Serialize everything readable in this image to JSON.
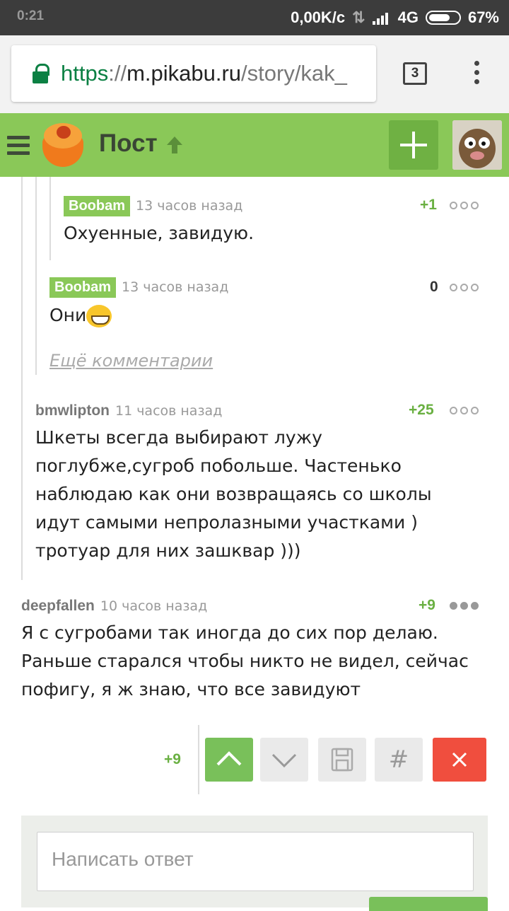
{
  "status": {
    "time": "0:21",
    "net": "0,00K/с",
    "network_type": "4G",
    "battery": "67%"
  },
  "browser": {
    "url_scheme": "https",
    "url_sep": "://",
    "url_host": "m.pikabu.ru",
    "url_path": "/story/kak_",
    "tab_count": "3"
  },
  "header": {
    "title": "Пост"
  },
  "comments": [
    {
      "user": "Boobam",
      "time": "13 часов назад",
      "rating": "+1",
      "text": "Охуенные, завидую."
    },
    {
      "user": "Boobam",
      "time": "13 часов назад",
      "rating": "0",
      "text": "Они"
    },
    {
      "more": "Ещё комментарии"
    },
    {
      "user": "bmwlipton",
      "time": "11 часов назад",
      "rating": "+25",
      "text_lines": [
        "Шкеты всегда выбирают лужу",
        "поглубже,сугроб побольше. Частенько",
        "наблюдаю как они возвращаясь со школы",
        "идут самыми непролазными участками )",
        "тротуар для них зашквар )))"
      ]
    },
    {
      "user": "deepfallen",
      "time": "10 часов назад",
      "rating": "+9",
      "text_lines": [
        "Я с сугробами так иногда до сих пор делаю.",
        "Раньше старался чтобы никто не видел, сейчас",
        "пофигу, я ж знаю, что все завидуют"
      ]
    }
  ],
  "actions": {
    "count": "+9",
    "hash": "#"
  },
  "reply": {
    "placeholder": "Написать ответ"
  }
}
